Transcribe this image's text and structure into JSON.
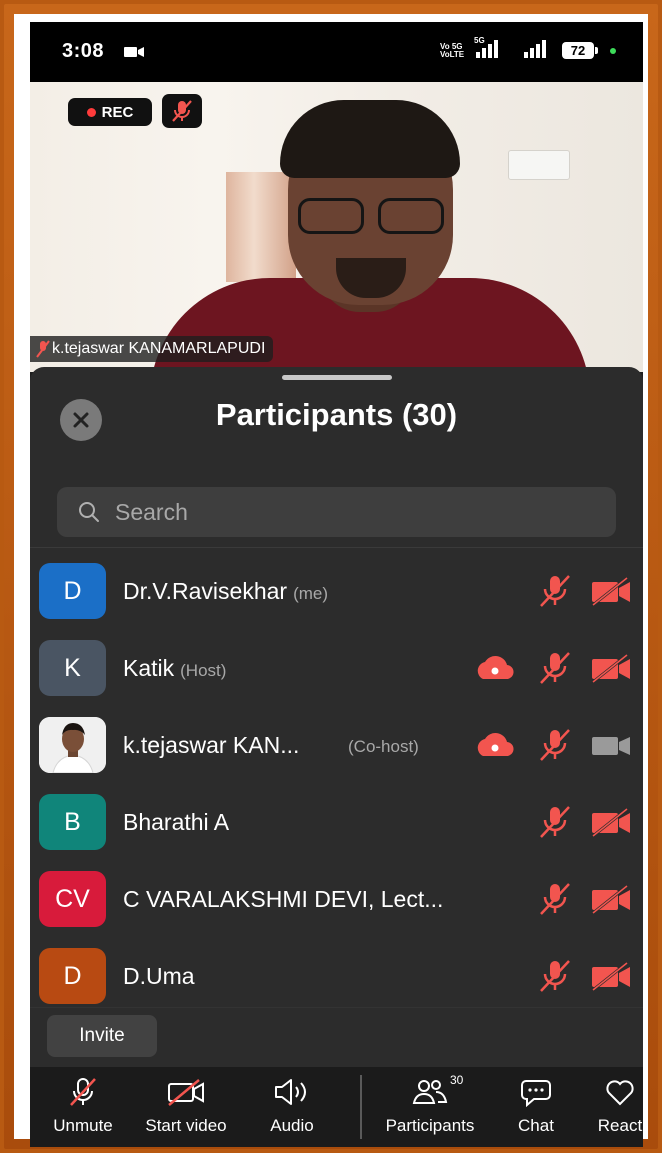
{
  "status_bar": {
    "time": "3:08",
    "network_volte": "Vo 5G",
    "network_volte2": "VoLTE",
    "network_5g": "5G",
    "battery": "72"
  },
  "video": {
    "rec_label": "REC",
    "participant_name": "k.tejaswar KANAMARLAPUDI"
  },
  "panel": {
    "title": "Participants (30)",
    "search_placeholder": "Search",
    "invite_label": "Invite"
  },
  "participants": [
    {
      "initials": "D",
      "name": "Dr.V.Ravisekhar",
      "role": "(me)",
      "avatar_color": "#1b6fc7"
    },
    {
      "initials": "K",
      "name": "Katik",
      "role": "(Host)",
      "avatar_color": "#4a5563"
    },
    {
      "initials": "",
      "name": "k.tejaswar KAN...",
      "role": "(Co-host)",
      "avatar_color": "#f2f2f2"
    },
    {
      "initials": "B",
      "name": "Bharathi A",
      "role": "",
      "avatar_color": "#10857a"
    },
    {
      "initials": "CV",
      "name": "C VARALAKSHMI DEVI, Lect...",
      "role": "",
      "avatar_color": "#d81b3b"
    },
    {
      "initials": "D",
      "name": "D.Uma",
      "role": "",
      "avatar_color": "#b84a12"
    }
  ],
  "toolbar": {
    "unmute": "Unmute",
    "start_video": "Start video",
    "audio": "Audio",
    "participants": "Participants",
    "participants_count": "30",
    "chat": "Chat",
    "react": "React"
  },
  "colors": {
    "accent_red": "#f2554f",
    "sheet_bg": "#2c2c2c"
  }
}
